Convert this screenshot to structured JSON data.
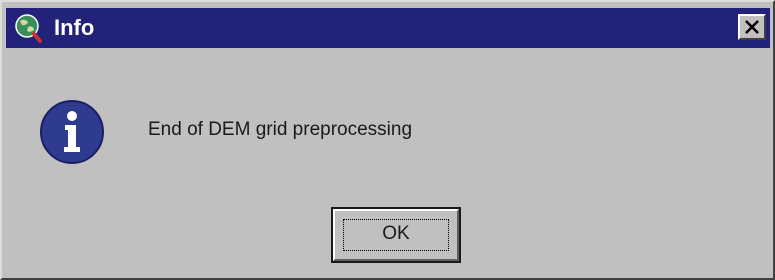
{
  "window": {
    "title": "Info",
    "title_icon": "globe-magnifier-icon",
    "close_icon": "close-icon"
  },
  "content": {
    "icon": "info-icon",
    "message": "End of DEM grid preprocessing"
  },
  "buttons": {
    "ok_label": "OK"
  },
  "colors": {
    "titlebar": "#22227a",
    "dialog_background": "#c0c0c0",
    "info_icon": "#2f3b8f"
  }
}
